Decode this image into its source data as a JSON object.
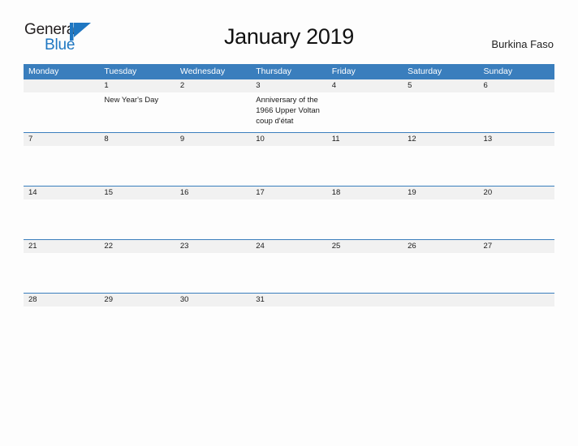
{
  "brand": {
    "word_one": "General",
    "word_two": "Blue",
    "flag_icon": "blue-flag-logo",
    "color_dark": "#231f20",
    "color_blue": "#1f77c2"
  },
  "header": {
    "title": "January 2019",
    "locale": "Burkina Faso"
  },
  "theme": {
    "header_blue": "#3a7ebd",
    "date_band_gray": "#f1f1f1",
    "page_background": "#fdfdfd"
  },
  "calendar": {
    "month": "January",
    "year": "2019",
    "weekday_headers": [
      "Monday",
      "Tuesday",
      "Wednesday",
      "Thursday",
      "Friday",
      "Saturday",
      "Sunday"
    ],
    "weeks": [
      {
        "days": [
          {
            "date": "",
            "event": ""
          },
          {
            "date": "1",
            "event": "New Year's Day"
          },
          {
            "date": "2",
            "event": ""
          },
          {
            "date": "3",
            "event": "Anniversary of the 1966 Upper Voltan coup d'état"
          },
          {
            "date": "4",
            "event": ""
          },
          {
            "date": "5",
            "event": ""
          },
          {
            "date": "6",
            "event": ""
          }
        ]
      },
      {
        "days": [
          {
            "date": "7",
            "event": ""
          },
          {
            "date": "8",
            "event": ""
          },
          {
            "date": "9",
            "event": ""
          },
          {
            "date": "10",
            "event": ""
          },
          {
            "date": "11",
            "event": ""
          },
          {
            "date": "12",
            "event": ""
          },
          {
            "date": "13",
            "event": ""
          }
        ]
      },
      {
        "days": [
          {
            "date": "14",
            "event": ""
          },
          {
            "date": "15",
            "event": ""
          },
          {
            "date": "16",
            "event": ""
          },
          {
            "date": "17",
            "event": ""
          },
          {
            "date": "18",
            "event": ""
          },
          {
            "date": "19",
            "event": ""
          },
          {
            "date": "20",
            "event": ""
          }
        ]
      },
      {
        "days": [
          {
            "date": "21",
            "event": ""
          },
          {
            "date": "22",
            "event": ""
          },
          {
            "date": "23",
            "event": ""
          },
          {
            "date": "24",
            "event": ""
          },
          {
            "date": "25",
            "event": ""
          },
          {
            "date": "26",
            "event": ""
          },
          {
            "date": "27",
            "event": ""
          }
        ]
      },
      {
        "days": [
          {
            "date": "28",
            "event": ""
          },
          {
            "date": "29",
            "event": ""
          },
          {
            "date": "30",
            "event": ""
          },
          {
            "date": "31",
            "event": ""
          },
          {
            "date": "",
            "event": ""
          },
          {
            "date": "",
            "event": ""
          },
          {
            "date": "",
            "event": ""
          }
        ]
      }
    ]
  }
}
